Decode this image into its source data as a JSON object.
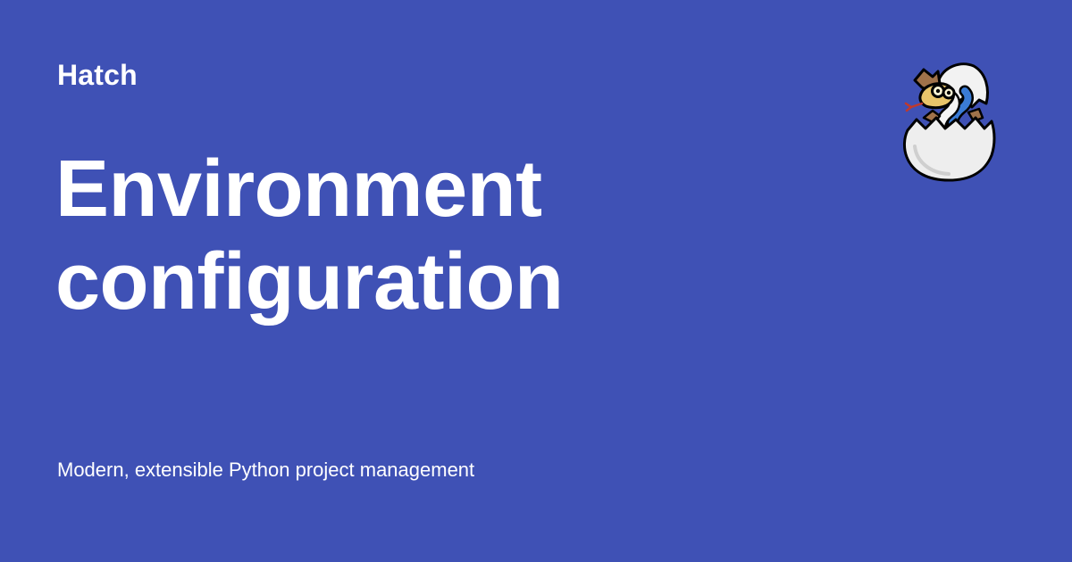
{
  "site": {
    "name": "Hatch",
    "logo_icon": "hatching-egg-snake-logo-icon"
  },
  "page": {
    "title_line_1": "Environment",
    "title_line_2": "configuration",
    "tagline": "Modern, extensible Python project management"
  },
  "colors": {
    "background": "#3f51b5",
    "text": "#ffffff"
  }
}
